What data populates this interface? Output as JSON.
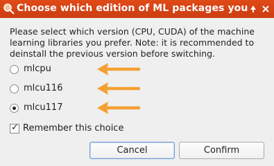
{
  "window": {
    "title": "Choose which edition of ML packages you",
    "controls": [
      "pin-icon",
      "close-icon"
    ]
  },
  "message": "Please select which version (CPU, CUDA) of the machine learning libraries you prefer. Note: it is recommended to deinstall the previous version before switching.",
  "options": [
    {
      "label": "mlcpu",
      "selected": false
    },
    {
      "label": "mlcu116",
      "selected": false
    },
    {
      "label": "mlcu117",
      "selected": true
    }
  ],
  "remember": {
    "label": "Remember this choice",
    "checked": true
  },
  "buttons": {
    "cancel": "Cancel",
    "confirm": "Confirm"
  },
  "colors": {
    "titlebar": "#d8451a",
    "arrow": "#f4a032"
  }
}
